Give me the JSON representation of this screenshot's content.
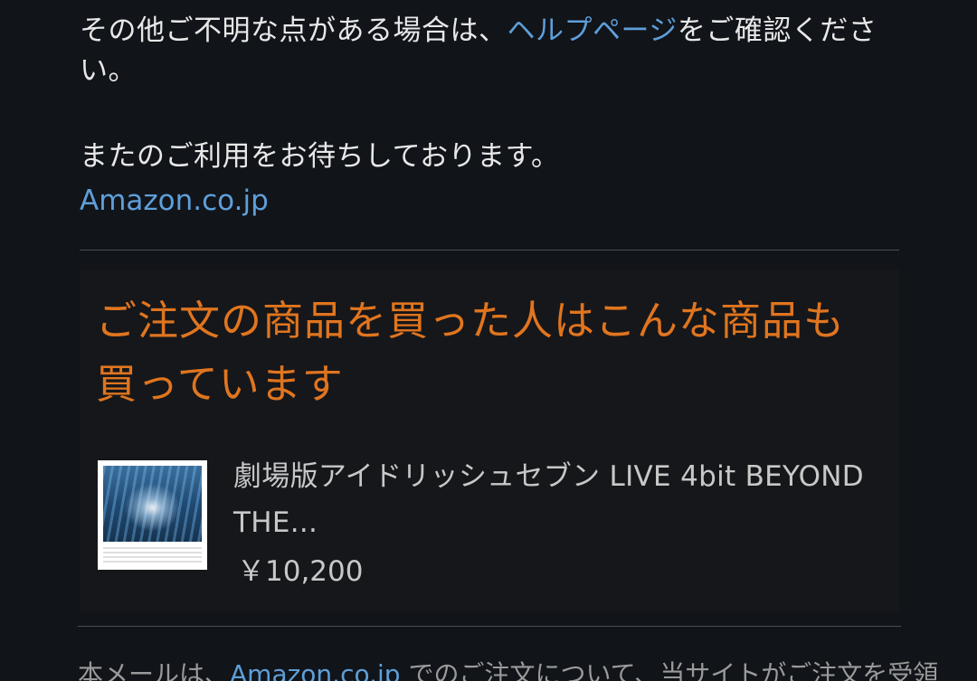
{
  "help_paragraph": {
    "prefix": "その他ご不明な点がある場合は、",
    "link": "ヘルプページ",
    "suffix": "をご確認ください。"
  },
  "closing": "またのご利用をお待ちしております。",
  "signature_link": "Amazon.co.jp",
  "recommendations": {
    "title": "ご注文の商品を買った人はこんな商品も買っています",
    "product": {
      "image_icon": "product-thumbnail",
      "name": "劇場版アイドリッシュセブン LIVE 4bit BEYOND THE...",
      "price": "￥10,200"
    }
  },
  "footer": {
    "prefix": "本メールは、",
    "link": "Amazon.co.jp",
    "suffix": " でのご注文について、当サイトがご注文を受領"
  },
  "colors": {
    "background": "#111419",
    "link": "#5e9fd9",
    "title": "#e0751f",
    "box": "#16171a"
  }
}
